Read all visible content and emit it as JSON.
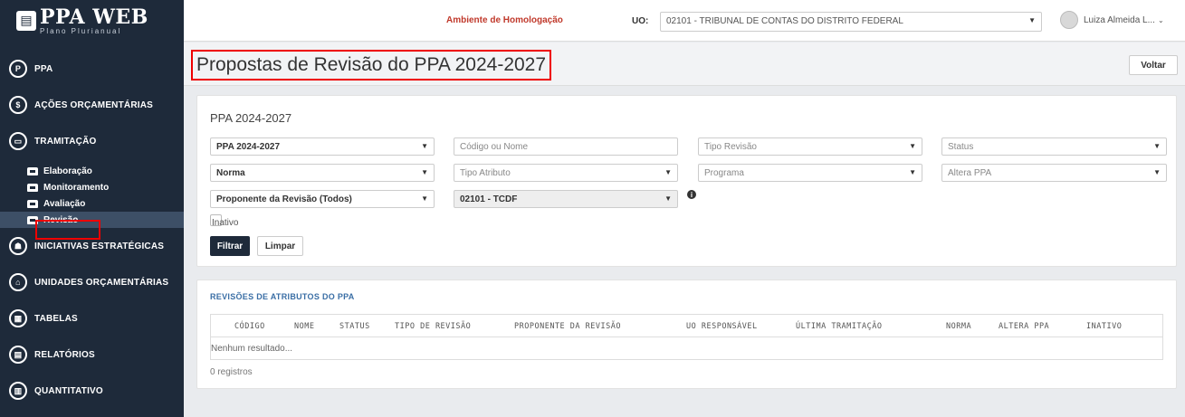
{
  "sidebar": {
    "logo_title": "PPA WEB",
    "logo_sub": "Plano Plurianual",
    "items": [
      {
        "label": "PPA",
        "icon": "P"
      },
      {
        "label": "AÇÕES ORÇAMENTÁRIAS",
        "icon": "$"
      },
      {
        "label": "TRAMITAÇÃO",
        "icon": "▭"
      },
      {
        "label": "INICIATIVAS ESTRATÉGICAS",
        "icon": "☗"
      },
      {
        "label": "UNIDADES ORÇAMENTÁRIAS",
        "icon": "⌂"
      },
      {
        "label": "TABELAS",
        "icon": "▦"
      },
      {
        "label": "RELATÓRIOS",
        "icon": "▤"
      },
      {
        "label": "QUANTITATIVO",
        "icon": "▥"
      }
    ],
    "sub_items": [
      "Elaboração",
      "Monitoramento",
      "Avaliação",
      "Revisão"
    ]
  },
  "topbar": {
    "environment": "Ambiente de Homologação",
    "uo_label": "UO:",
    "uo_value": "02101 - TRIBUNAL DE CONTAS DO DISTRITO FEDERAL",
    "user": "Luiza Almeida L..."
  },
  "page": {
    "title": "Propostas de Revisão do PPA 2024-2027",
    "back_label": "Voltar"
  },
  "filters": {
    "title": "PPA 2024-2027",
    "ppa": "PPA 2024-2027",
    "codigo_placeholder": "Código ou Nome",
    "tipo_revisao": "Tipo Revisão",
    "status": "Status",
    "norma": "Norma",
    "tipo_atributo": "Tipo Atributo",
    "programa": "Programa",
    "altera_ppa": "Altera PPA",
    "proponente": "Proponente da Revisão (Todos)",
    "uo": "02101 - TCDF",
    "inativo_label": "Inativo",
    "filtrar": "Filtrar",
    "limpar": "Limpar"
  },
  "results": {
    "title": "REVISÕES DE ATRIBUTOS DO PPA",
    "columns": [
      "CÓDIGO",
      "NOME",
      "STATUS",
      "TIPO DE REVISÃO",
      "PROPONENTE DA REVISÃO",
      "UO RESPONSÁVEL",
      "ÚLTIMA TRAMITAÇÃO",
      "NORMA",
      "ALTERA PPA",
      "INATIVO"
    ],
    "empty": "Nenhum resultado...",
    "count": "0 registros"
  }
}
